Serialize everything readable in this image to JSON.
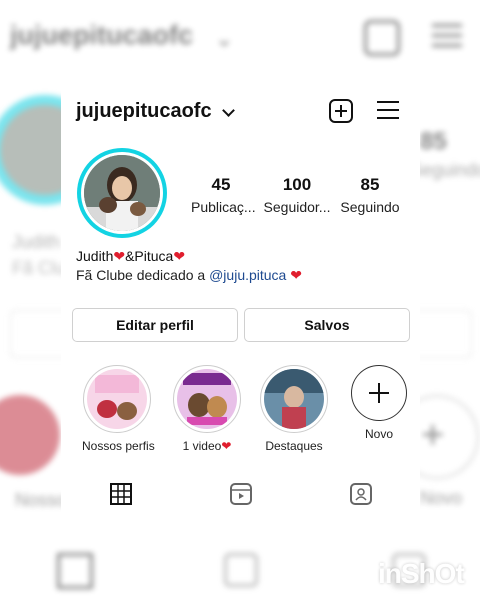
{
  "profile": {
    "username": "jujuepitucaofc",
    "stats": [
      {
        "value": "45",
        "label": "Publicaç..."
      },
      {
        "value": "100",
        "label": "Seguidor..."
      },
      {
        "value": "85",
        "label": "Seguindo"
      }
    ],
    "bio_name": "Judith",
    "bio_name_mid": "&Pituca",
    "bio_heart": "❤",
    "bio_line": "Fã Clube dedicado a ",
    "bio_link": "@juju.pituca",
    "bio_tail": " ❤"
  },
  "buttons": {
    "edit": "Editar perfil",
    "saved": "Salvos"
  },
  "highlights": [
    {
      "label": "Nossos perfis"
    },
    {
      "label": "1 video"
    },
    {
      "label": "Destaques"
    },
    {
      "label": "Novo"
    }
  ],
  "highlight_heart": "❤",
  "tabs": [
    "grid-icon",
    "reels-icon",
    "tagged-icon"
  ],
  "watermark": "inShOt",
  "colors": {
    "story_ring": "#13d3e3",
    "link": "#1e4a90",
    "heart": "#e01e2e"
  }
}
